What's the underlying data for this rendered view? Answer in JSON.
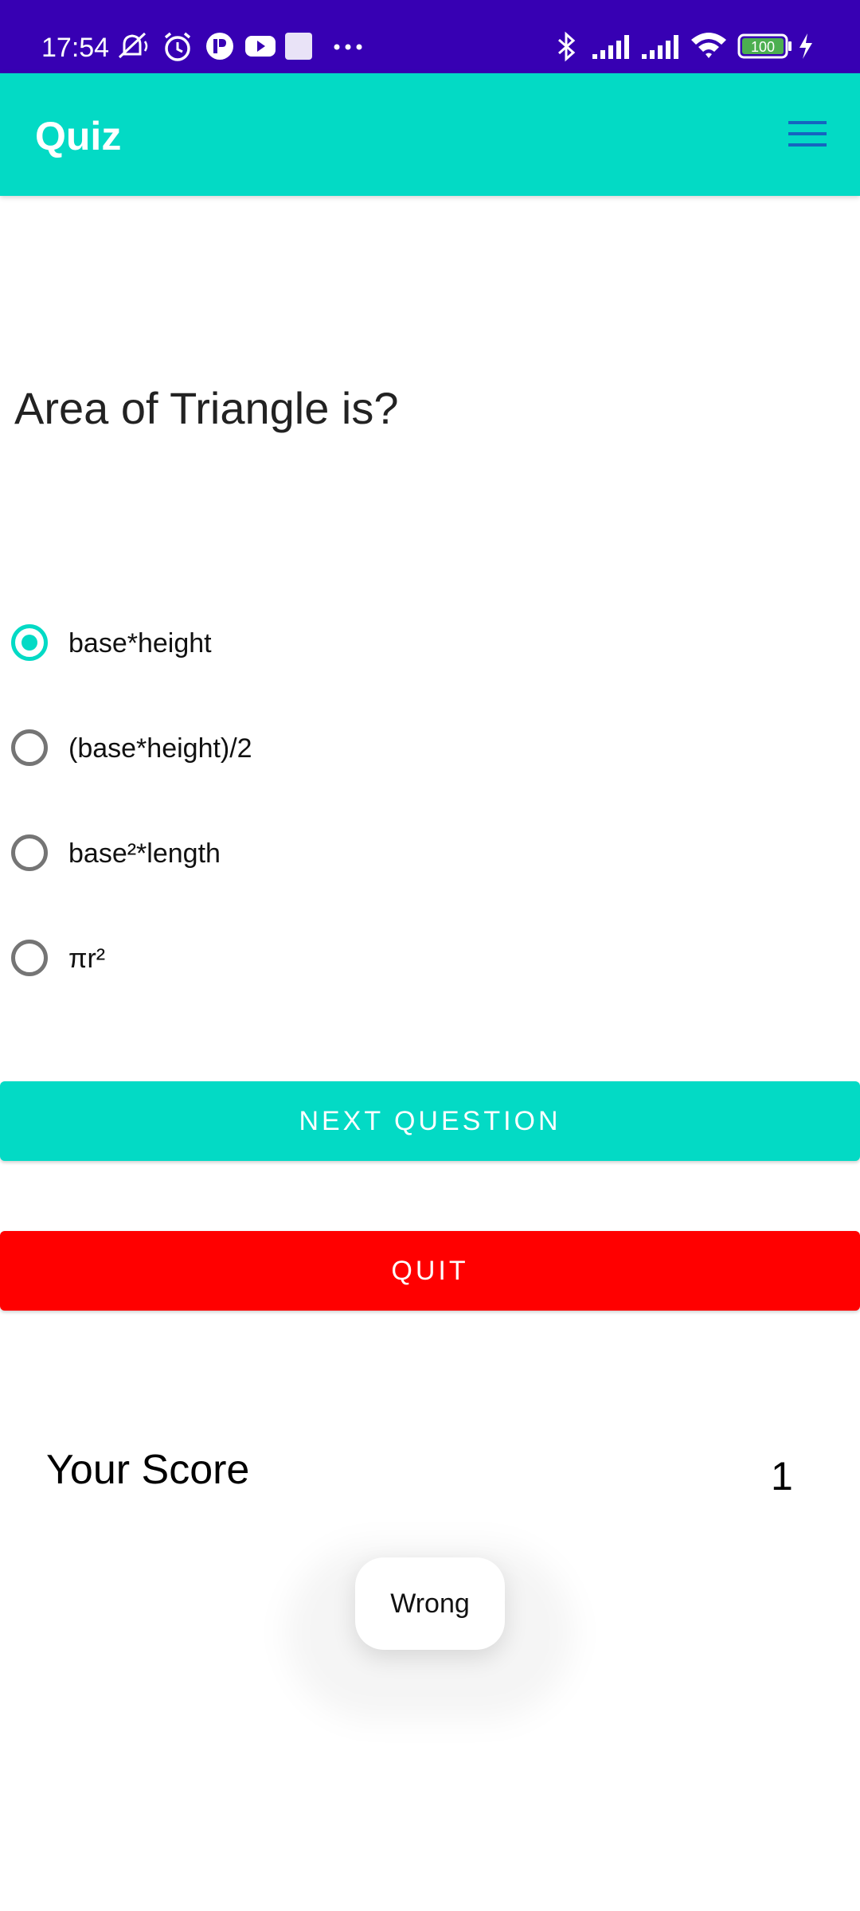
{
  "status_bar": {
    "time": "17:54",
    "battery": "100",
    "icons": [
      "mute-icon",
      "alarm-icon",
      "app-icon",
      "youtube-icon",
      "square-icon",
      "more-icon",
      "bluetooth-icon",
      "signal-icon",
      "signal-icon",
      "wifi-icon",
      "battery-icon",
      "charging-icon"
    ],
    "bg_color": "#3700B3"
  },
  "app_bar": {
    "title": "Quiz",
    "bg_color": "#03DAC5",
    "menu_icon": "hamburger-menu-icon",
    "menu_color": "#1565C0"
  },
  "question": {
    "text": "Area of Triangle is?"
  },
  "options": [
    {
      "label": "base*height",
      "selected": true
    },
    {
      "label": "(base*height)/2",
      "selected": false
    },
    {
      "label": "base²*length",
      "selected": false
    },
    {
      "label": "πr²",
      "selected": false
    }
  ],
  "buttons": {
    "next_label": "NEXT QUESTION",
    "next_color": "#03DAC5",
    "quit_label": "QUIT",
    "quit_color": "#FF0000"
  },
  "score": {
    "label": "Your Score",
    "value": "1"
  },
  "toast": {
    "text": "Wrong"
  }
}
